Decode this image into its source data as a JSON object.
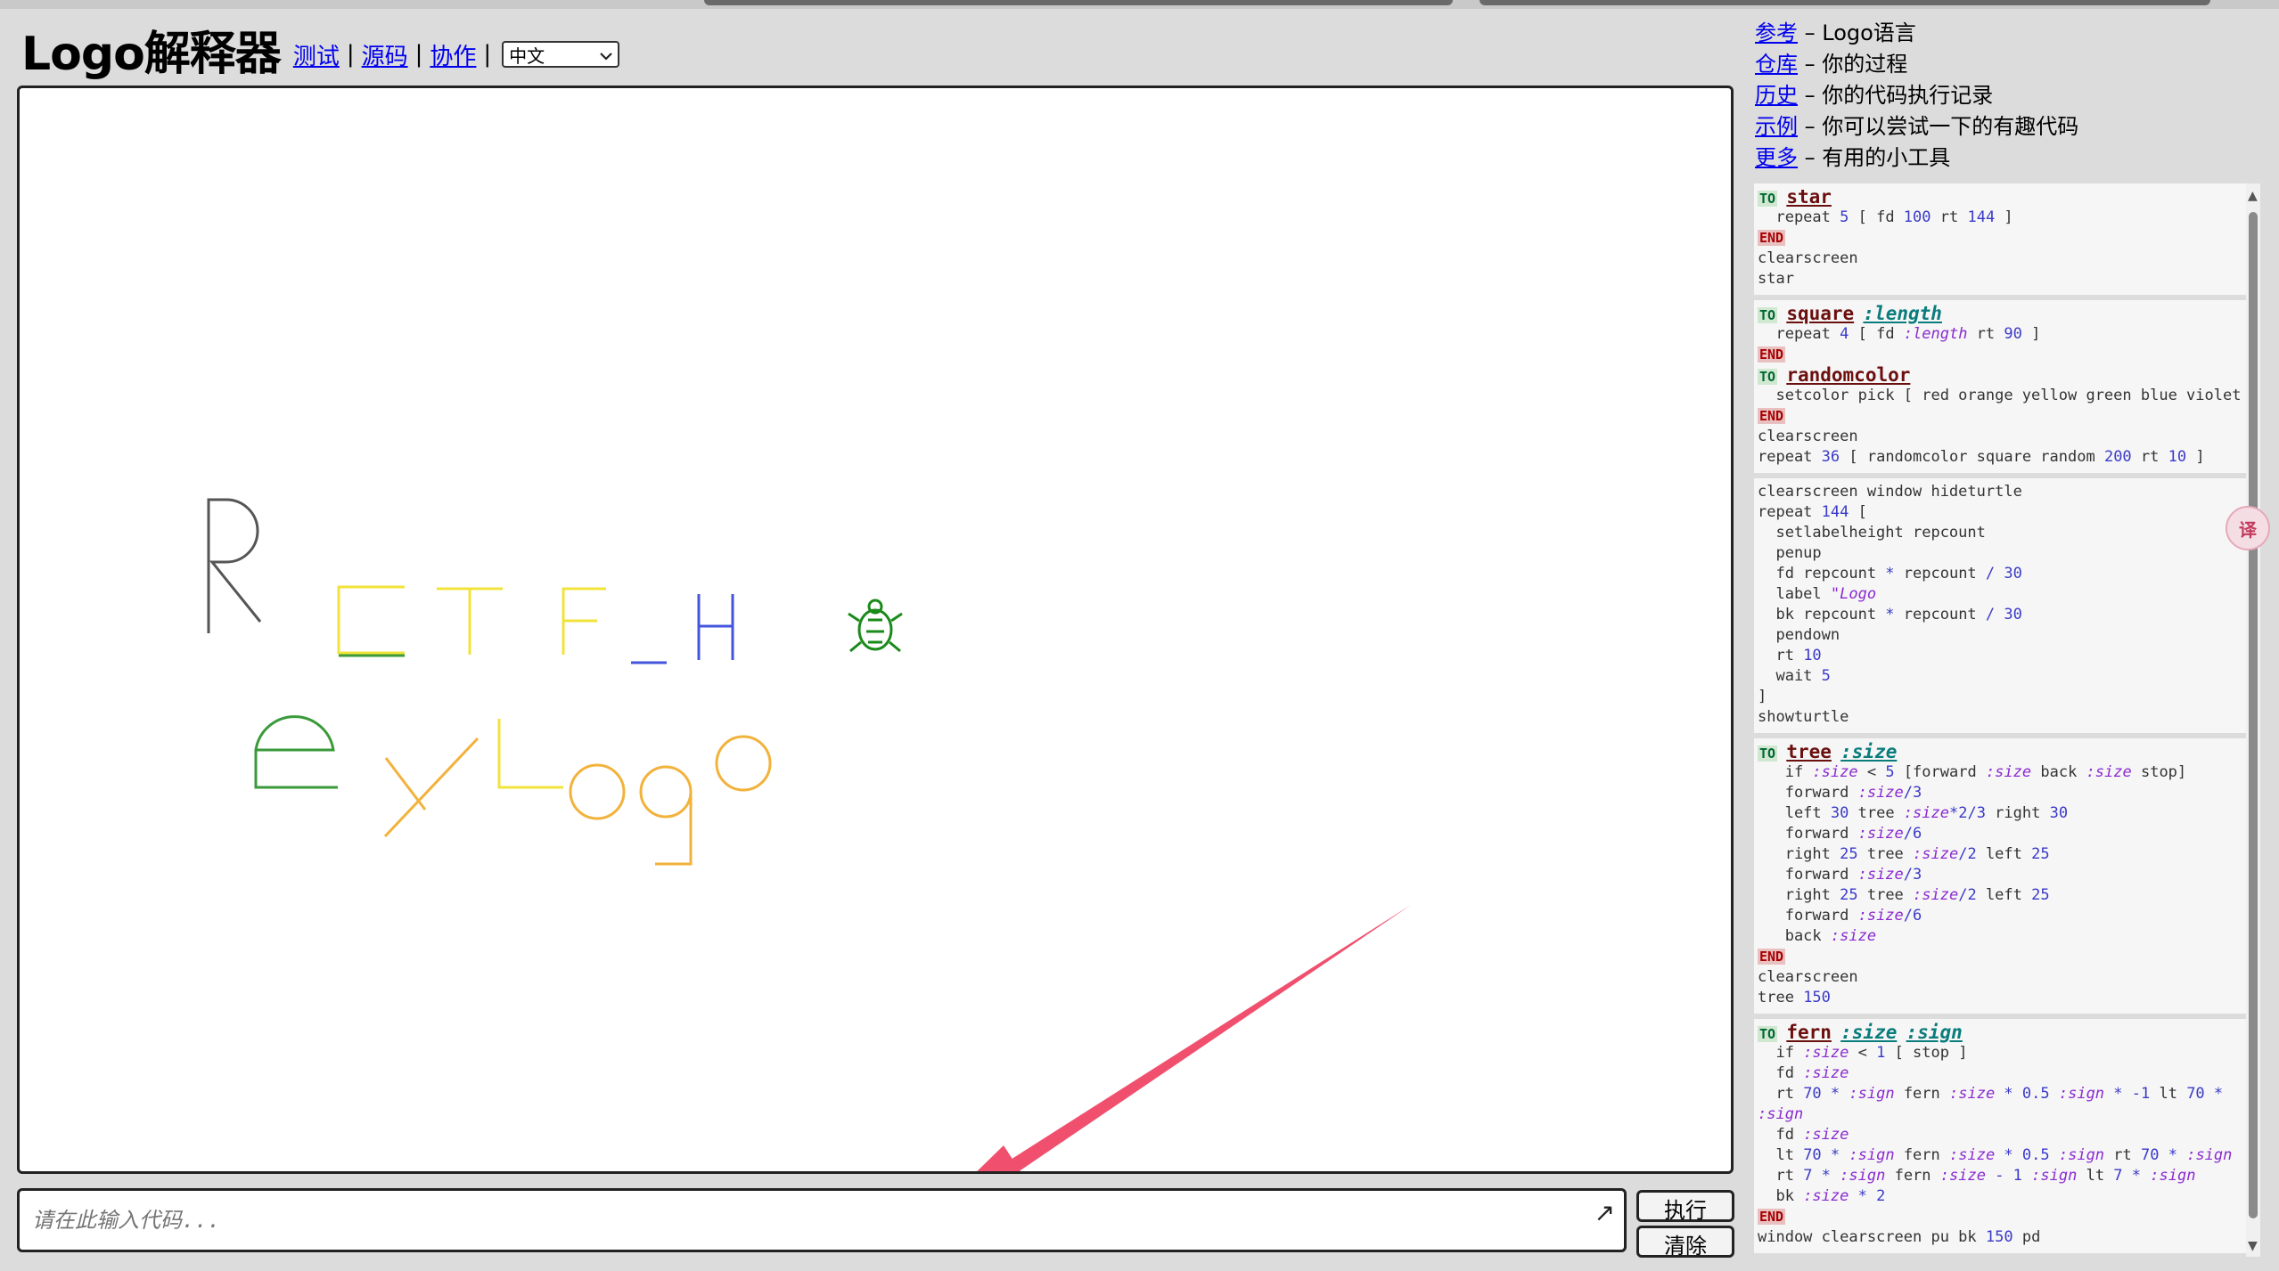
{
  "header": {
    "title": "Logo解释器",
    "nav": [
      {
        "label": "测试"
      },
      {
        "label": "源码"
      },
      {
        "label": "协作"
      }
    ],
    "separator": "|",
    "language": {
      "selected": "中文",
      "icon": "chevron-down-icon"
    }
  },
  "links": [
    {
      "link": "参考",
      "desc": " – Logo语言"
    },
    {
      "link": "仓库",
      "desc": " – 你的过程"
    },
    {
      "link": "历史",
      "desc": " – 你的代码执行记录"
    },
    {
      "link": "示例",
      "desc": " – 你可以尝试一下的有趣代码"
    },
    {
      "link": "更多",
      "desc": " – 有用的小工具"
    }
  ],
  "input": {
    "placeholder": "请在此输入代码...",
    "expand_icon": "expand-arrow-icon"
  },
  "buttons": {
    "run": "执行",
    "clear": "清除"
  },
  "translate_widget": {
    "label": "译",
    "icon": "translate-icon"
  },
  "colors": {
    "canvas_bg": "#ffffff",
    "panel_bg": "#dcdcdc",
    "arrow": "#f0506e"
  },
  "library": [
    {
      "lines": [
        [
          {
            "c": "to",
            "t": "TO"
          },
          {
            "c": "sp",
            "t": " "
          },
          {
            "c": "pname",
            "t": "star"
          }
        ],
        [
          {
            "c": "kw",
            "t": "  repeat "
          },
          {
            "c": "num",
            "t": "5"
          },
          {
            "c": "kw",
            "t": " [ fd "
          },
          {
            "c": "num",
            "t": "100"
          },
          {
            "c": "kw",
            "t": " rt "
          },
          {
            "c": "num",
            "t": "144"
          },
          {
            "c": "kw",
            "t": " ]"
          }
        ],
        [
          {
            "c": "end",
            "t": "END"
          }
        ],
        [
          {
            "c": "kw",
            "t": "clearscreen"
          }
        ],
        [
          {
            "c": "kw",
            "t": "star"
          }
        ]
      ]
    },
    {
      "lines": [
        [
          {
            "c": "to",
            "t": "TO"
          },
          {
            "c": "sp",
            "t": " "
          },
          {
            "c": "pname",
            "t": "square"
          },
          {
            "c": "sp",
            "t": " "
          },
          {
            "c": "pvar",
            "t": ":length"
          }
        ],
        [
          {
            "c": "kw",
            "t": "  repeat "
          },
          {
            "c": "num",
            "t": "4"
          },
          {
            "c": "kw",
            "t": " [ fd "
          },
          {
            "c": "v",
            "t": ":length"
          },
          {
            "c": "kw",
            "t": " rt "
          },
          {
            "c": "num",
            "t": "90"
          },
          {
            "c": "kw",
            "t": " ]"
          }
        ],
        [
          {
            "c": "end",
            "t": "END"
          }
        ],
        [
          {
            "c": "to",
            "t": "TO"
          },
          {
            "c": "sp",
            "t": " "
          },
          {
            "c": "pname",
            "t": "randomcolor"
          }
        ],
        [
          {
            "c": "kw",
            "t": "  setcolor pick [ red orange yellow green blue violet ]"
          }
        ],
        [
          {
            "c": "end",
            "t": "END"
          }
        ],
        [
          {
            "c": "kw",
            "t": "clearscreen"
          }
        ],
        [
          {
            "c": "kw",
            "t": "repeat "
          },
          {
            "c": "num",
            "t": "36"
          },
          {
            "c": "kw",
            "t": " [ randomcolor square random "
          },
          {
            "c": "num",
            "t": "200"
          },
          {
            "c": "kw",
            "t": " rt "
          },
          {
            "c": "num",
            "t": "10"
          },
          {
            "c": "kw",
            "t": " ]"
          }
        ]
      ]
    },
    {
      "lines": [
        [
          {
            "c": "kw",
            "t": "clearscreen window hideturtle"
          }
        ],
        [
          {
            "c": "kw",
            "t": "repeat "
          },
          {
            "c": "num",
            "t": "144"
          },
          {
            "c": "kw",
            "t": " ["
          }
        ],
        [
          {
            "c": "kw",
            "t": "  setlabelheight repcount"
          }
        ],
        [
          {
            "c": "kw",
            "t": "  penup"
          }
        ],
        [
          {
            "c": "kw",
            "t": "  fd repcount "
          },
          {
            "c": "num",
            "t": "*"
          },
          {
            "c": "kw",
            "t": " repcount "
          },
          {
            "c": "num",
            "t": "/ 30"
          }
        ],
        [
          {
            "c": "kw",
            "t": "  label "
          },
          {
            "c": "v",
            "t": "\"Logo"
          }
        ],
        [
          {
            "c": "kw",
            "t": "  bk repcount "
          },
          {
            "c": "num",
            "t": "*"
          },
          {
            "c": "kw",
            "t": " repcount "
          },
          {
            "c": "num",
            "t": "/ 30"
          }
        ],
        [
          {
            "c": "kw",
            "t": "  pendown"
          }
        ],
        [
          {
            "c": "kw",
            "t": "  rt "
          },
          {
            "c": "num",
            "t": "10"
          }
        ],
        [
          {
            "c": "kw",
            "t": "  wait "
          },
          {
            "c": "num",
            "t": "5"
          }
        ],
        [
          {
            "c": "kw",
            "t": "]"
          }
        ],
        [
          {
            "c": "kw",
            "t": "showturtle"
          }
        ]
      ]
    },
    {
      "lines": [
        [
          {
            "c": "to",
            "t": "TO"
          },
          {
            "c": "sp",
            "t": " "
          },
          {
            "c": "pname",
            "t": "tree"
          },
          {
            "c": "sp",
            "t": " "
          },
          {
            "c": "pvar",
            "t": ":size"
          }
        ],
        [
          {
            "c": "kw",
            "t": "   if "
          },
          {
            "c": "v",
            "t": ":size"
          },
          {
            "c": "kw",
            "t": " < "
          },
          {
            "c": "num",
            "t": "5"
          },
          {
            "c": "kw",
            "t": " [forward "
          },
          {
            "c": "v",
            "t": ":size"
          },
          {
            "c": "kw",
            "t": " back "
          },
          {
            "c": "v",
            "t": ":size"
          },
          {
            "c": "kw",
            "t": " stop]"
          }
        ],
        [
          {
            "c": "kw",
            "t": "   forward "
          },
          {
            "c": "v",
            "t": ":size"
          },
          {
            "c": "num",
            "t": "/3"
          }
        ],
        [
          {
            "c": "kw",
            "t": "   left "
          },
          {
            "c": "num",
            "t": "30"
          },
          {
            "c": "kw",
            "t": " tree "
          },
          {
            "c": "v",
            "t": ":size"
          },
          {
            "c": "num",
            "t": "*2/3"
          },
          {
            "c": "kw",
            "t": " right "
          },
          {
            "c": "num",
            "t": "30"
          }
        ],
        [
          {
            "c": "kw",
            "t": "   forward "
          },
          {
            "c": "v",
            "t": ":size"
          },
          {
            "c": "num",
            "t": "/6"
          }
        ],
        [
          {
            "c": "kw",
            "t": "   right "
          },
          {
            "c": "num",
            "t": "25"
          },
          {
            "c": "kw",
            "t": " tree "
          },
          {
            "c": "v",
            "t": ":size"
          },
          {
            "c": "num",
            "t": "/2"
          },
          {
            "c": "kw",
            "t": " left "
          },
          {
            "c": "num",
            "t": "25"
          }
        ],
        [
          {
            "c": "kw",
            "t": "   forward "
          },
          {
            "c": "v",
            "t": ":size"
          },
          {
            "c": "num",
            "t": "/3"
          }
        ],
        [
          {
            "c": "kw",
            "t": "   right "
          },
          {
            "c": "num",
            "t": "25"
          },
          {
            "c": "kw",
            "t": " tree "
          },
          {
            "c": "v",
            "t": ":size"
          },
          {
            "c": "num",
            "t": "/2"
          },
          {
            "c": "kw",
            "t": " left "
          },
          {
            "c": "num",
            "t": "25"
          }
        ],
        [
          {
            "c": "kw",
            "t": "   forward "
          },
          {
            "c": "v",
            "t": ":size"
          },
          {
            "c": "num",
            "t": "/6"
          }
        ],
        [
          {
            "c": "kw",
            "t": "   back "
          },
          {
            "c": "v",
            "t": ":size"
          }
        ],
        [
          {
            "c": "end",
            "t": "END"
          }
        ],
        [
          {
            "c": "kw",
            "t": "clearscreen"
          }
        ],
        [
          {
            "c": "kw",
            "t": "tree "
          },
          {
            "c": "num",
            "t": "150"
          }
        ]
      ]
    },
    {
      "lines": [
        [
          {
            "c": "to",
            "t": "TO"
          },
          {
            "c": "sp",
            "t": " "
          },
          {
            "c": "pname",
            "t": "fern"
          },
          {
            "c": "sp",
            "t": " "
          },
          {
            "c": "pvar",
            "t": ":size"
          },
          {
            "c": "sp",
            "t": " "
          },
          {
            "c": "pvar",
            "t": ":sign"
          }
        ],
        [
          {
            "c": "kw",
            "t": "  if "
          },
          {
            "c": "v",
            "t": ":size"
          },
          {
            "c": "kw",
            "t": " < "
          },
          {
            "c": "num",
            "t": "1"
          },
          {
            "c": "kw",
            "t": " [ stop ]"
          }
        ],
        [
          {
            "c": "kw",
            "t": "  fd "
          },
          {
            "c": "v",
            "t": ":size"
          }
        ],
        [
          {
            "c": "kw",
            "t": "  rt "
          },
          {
            "c": "num",
            "t": "70 *"
          },
          {
            "c": "kw",
            "t": " "
          },
          {
            "c": "v",
            "t": ":sign"
          },
          {
            "c": "kw",
            "t": " fern "
          },
          {
            "c": "v",
            "t": ":size"
          },
          {
            "c": "num",
            "t": " * 0.5"
          },
          {
            "c": "kw",
            "t": " "
          },
          {
            "c": "v",
            "t": ":sign"
          },
          {
            "c": "num",
            "t": " * -1"
          },
          {
            "c": "kw",
            "t": " lt "
          },
          {
            "c": "num",
            "t": "70 *"
          }
        ],
        [
          {
            "c": "v",
            "t": ":sign"
          }
        ],
        [
          {
            "c": "kw",
            "t": "  fd "
          },
          {
            "c": "v",
            "t": ":size"
          }
        ],
        [
          {
            "c": "kw",
            "t": "  lt "
          },
          {
            "c": "num",
            "t": "70 *"
          },
          {
            "c": "kw",
            "t": " "
          },
          {
            "c": "v",
            "t": ":sign"
          },
          {
            "c": "kw",
            "t": " fern "
          },
          {
            "c": "v",
            "t": ":size"
          },
          {
            "c": "num",
            "t": " * 0.5"
          },
          {
            "c": "kw",
            "t": " "
          },
          {
            "c": "v",
            "t": ":sign"
          },
          {
            "c": "kw",
            "t": " rt "
          },
          {
            "c": "num",
            "t": "70 *"
          },
          {
            "c": "kw",
            "t": " "
          },
          {
            "c": "v",
            "t": ":sign"
          }
        ],
        [
          {
            "c": "kw",
            "t": "  rt "
          },
          {
            "c": "num",
            "t": "7 *"
          },
          {
            "c": "kw",
            "t": " "
          },
          {
            "c": "v",
            "t": ":sign"
          },
          {
            "c": "kw",
            "t": " fern "
          },
          {
            "c": "v",
            "t": ":size"
          },
          {
            "c": "num",
            "t": " - 1"
          },
          {
            "c": "kw",
            "t": " "
          },
          {
            "c": "v",
            "t": ":sign"
          },
          {
            "c": "kw",
            "t": " lt "
          },
          {
            "c": "num",
            "t": "7 *"
          },
          {
            "c": "kw",
            "t": " "
          },
          {
            "c": "v",
            "t": ":sign"
          }
        ],
        [
          {
            "c": "kw",
            "t": "  bk "
          },
          {
            "c": "v",
            "t": ":size"
          },
          {
            "c": "num",
            "t": " * 2"
          }
        ],
        [
          {
            "c": "end",
            "t": "END"
          }
        ],
        [
          {
            "c": "kw",
            "t": "window clearscreen pu bk "
          },
          {
            "c": "num",
            "t": "150"
          },
          {
            "c": "kw",
            "t": " pd"
          }
        ]
      ]
    }
  ]
}
